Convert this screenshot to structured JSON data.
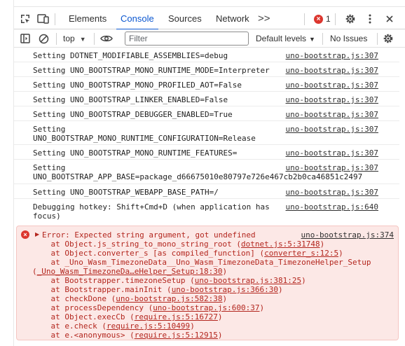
{
  "tabs": [
    {
      "label": "Elements",
      "active": false
    },
    {
      "label": "Console",
      "active": true
    },
    {
      "label": "Sources",
      "active": false
    },
    {
      "label": "Network",
      "active": false
    }
  ],
  "more_tabs": ">>",
  "error_count": "1",
  "toolbar": {
    "context": "top",
    "filter_placeholder": "Filter",
    "levels": "Default levels",
    "issues": "No Issues"
  },
  "logs": [
    {
      "message": "Setting DOTNET_MODIFIABLE_ASSEMBLIES=debug",
      "source": "uno-bootstrap.js:307"
    },
    {
      "message": "Setting UNO_BOOTSTRAP_MONO_RUNTIME_MODE=Interpreter",
      "source": "uno-bootstrap.js:307"
    },
    {
      "message": "Setting UNO_BOOTSTRAP_MONO_PROFILED_AOT=False",
      "source": "uno-bootstrap.js:307"
    },
    {
      "message": "Setting UNO_BOOTSTRAP_LINKER_ENABLED=False",
      "source": "uno-bootstrap.js:307"
    },
    {
      "message": "Setting UNO_BOOTSTRAP_DEBUGGER_ENABLED=True",
      "source": "uno-bootstrap.js:307"
    },
    {
      "message": "Setting\nUNO_BOOTSTRAP_MONO_RUNTIME_CONFIGURATION=Release",
      "source": "uno-bootstrap.js:307"
    },
    {
      "message": "Setting UNO_BOOTSTRAP_MONO_RUNTIME_FEATURES=",
      "source": "uno-bootstrap.js:307"
    },
    {
      "message": "Setting\nUNO_BOOTSTRAP_APP_BASE=package_d66675010e80797e726e467cb2b0ca46851c2497",
      "source": "uno-bootstrap.js:307"
    },
    {
      "message": "Setting UNO_BOOTSTRAP_WEBAPP_BASE_PATH=/",
      "source": "uno-bootstrap.js:307"
    },
    {
      "message": "Debugging hotkey: Shift+Cmd+D (when application has\nfocus)",
      "source": "uno-bootstrap.js:640"
    }
  ],
  "error": {
    "message": "Error: Expected string argument, got undefined",
    "source": "uno-bootstrap.js:374",
    "stack": [
      {
        "pre": "    at Object.js_string_to_mono_string_root (",
        "link": "dotnet.js:5:31748",
        "post": ")"
      },
      {
        "pre": "    at Object.converter_s [as compiled_function] (",
        "link": "converter_s:12:5",
        "post": ")"
      },
      {
        "pre": "    at _Uno_Wasm_TimezoneData__Uno_Wasm_TimezoneData_TimezoneHelper_Setup",
        "link": "",
        "post": ""
      },
      {
        "pre": "(",
        "link": "_Uno_Wasm_TimezoneDa…eHelper_Setup:18:30",
        "post": ")"
      },
      {
        "pre": "    at Bootstrapper.timezoneSetup (",
        "link": "uno-bootstrap.js:381:25",
        "post": ")"
      },
      {
        "pre": "    at Bootstrapper.mainInit (",
        "link": "uno-bootstrap.js:366:30",
        "post": ")"
      },
      {
        "pre": "    at checkDone (",
        "link": "uno-bootstrap.js:582:38",
        "post": ")"
      },
      {
        "pre": "    at processDependency (",
        "link": "uno-bootstrap.js:600:37",
        "post": ")"
      },
      {
        "pre": "    at Object.execCb (",
        "link": "require.js:5:16727",
        "post": ")"
      },
      {
        "pre": "    at e.check (",
        "link": "require.js:5:10499",
        "post": ")"
      },
      {
        "pre": "    at e.<anonymous> (",
        "link": "require.js:5:12915",
        "post": ")"
      }
    ]
  },
  "colors": {
    "accent": "#0b57d0",
    "error_text": "#b3261e",
    "error_bg": "#fce8e6",
    "error_icon": "#dc362e"
  },
  "icons": [
    "inspect-element-icon",
    "device-toolbar-icon",
    "error-circle-icon",
    "gear-icon",
    "kebab-menu-icon",
    "close-icon",
    "sidebar-toggle-icon",
    "clear-console-icon",
    "eye-icon",
    "settings-gear-icon"
  ]
}
